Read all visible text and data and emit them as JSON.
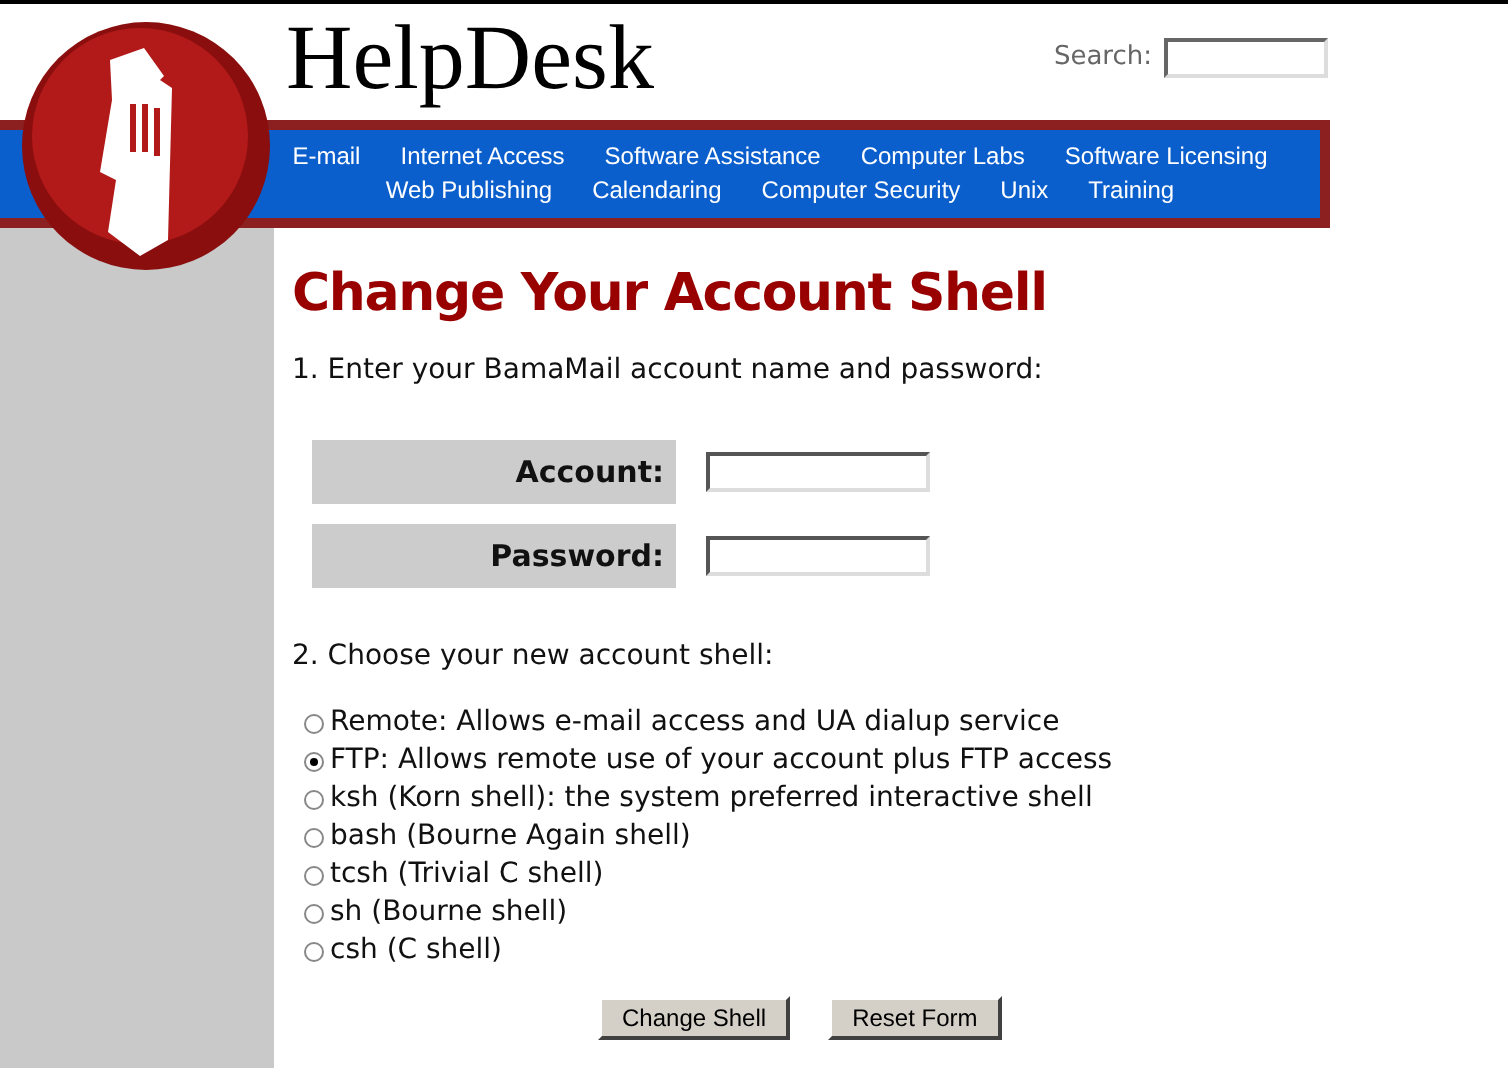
{
  "site_title": "HelpDesk",
  "search": {
    "label": "Search:"
  },
  "nav_rows": [
    [
      "E-mail",
      "Internet Access",
      "Software Assistance",
      "Computer Labs",
      "Software Licensing"
    ],
    [
      "Web Publishing",
      "Calendaring",
      "Computer Security",
      "Unix",
      "Training"
    ]
  ],
  "heading": "Change Your Account Shell",
  "step_1": "1. Enter your BamaMail account name and password:",
  "fields": [
    "Account:",
    "Password:"
  ],
  "step_2": "2. Choose your new account shell:",
  "shells": [
    {
      "label": "Remote: Allows e-mail access and UA dialup service",
      "selected": false
    },
    {
      "label": "FTP: Allows remote use of your account plus FTP access",
      "selected": true
    },
    {
      "label": "ksh (Korn shell): the system preferred interactive shell",
      "selected": false
    },
    {
      "label": "bash (Bourne Again shell)",
      "selected": false
    },
    {
      "label": "tcsh (Trivial C shell)",
      "selected": false
    },
    {
      "label": "sh (Bourne shell)",
      "selected": false
    },
    {
      "label": "csh (C shell)",
      "selected": false
    }
  ],
  "buttons": [
    "Change Shell",
    "Reset Form"
  ]
}
